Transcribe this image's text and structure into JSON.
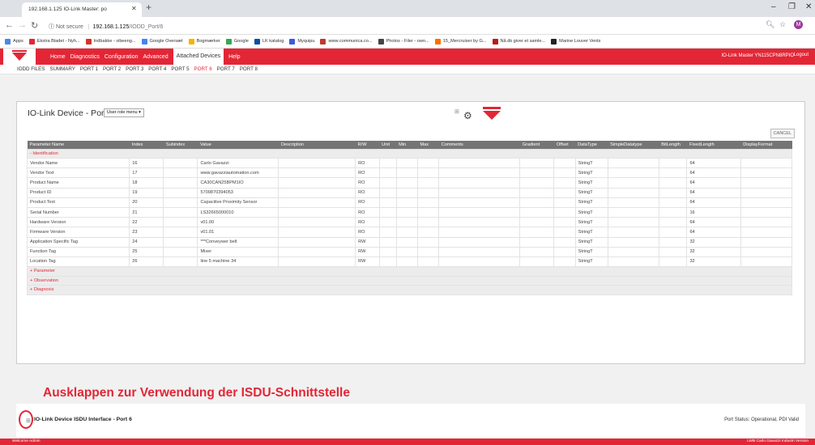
{
  "browser": {
    "tab_title": "192.168.1.125 IO-Link Master: po",
    "address_security": "Not secure",
    "address_host": "192.168.1.125",
    "address_path": "/IODD_Port/6",
    "avatar_letter": "M",
    "bookmarks": [
      {
        "label": "Apps",
        "color": "#4a87e6"
      },
      {
        "label": "Ekstra Bladet - Nyh...",
        "color": "#e32636"
      },
      {
        "label": "Indbakke - vibeeng...",
        "color": "#d93025"
      },
      {
        "label": "Google Oversæt",
        "color": "#4285f4"
      },
      {
        "label": "Bogmærker",
        "color": "#f4b400"
      },
      {
        "label": "Google",
        "color": "#34a853"
      },
      {
        "label": "LK katalog",
        "color": "#0b4ea2"
      },
      {
        "label": "Myquipu",
        "color": "#3b5bdb"
      },
      {
        "label": "www.communica.co...",
        "color": "#c0392b"
      },
      {
        "label": "Photos - Filer - own...",
        "color": "#444444"
      },
      {
        "label": "15_Mercruiser by G...",
        "color": "#ff6d00"
      },
      {
        "label": "Nå.dk giver et samle...",
        "color": "#b71c1c"
      },
      {
        "label": "Marine Louver Vents",
        "color": "#222222"
      }
    ]
  },
  "app": {
    "menu": [
      "Home",
      "Diagnostics",
      "Configuration",
      "Advanced",
      "Attached Devices",
      "Help"
    ],
    "menu_active": "Attached Devices",
    "master_label": "IO-Link Master YN115CPN8RPIO",
    "logout_label": "Logout",
    "subnav": [
      "IODD FILES",
      "SUMMARY",
      "PORT 1",
      "PORT 2",
      "PORT 3",
      "PORT 4",
      "PORT 5",
      "PORT 6",
      "PORT 7",
      "PORT 8"
    ],
    "subnav_active": "PORT 6"
  },
  "panel": {
    "title": "IO-Link Device - Port 6",
    "role_select": "User role menu ▾",
    "cancel_label": "CANCEL",
    "columns": [
      "Parameter Name",
      "Index",
      "Subindex",
      "Value",
      "Description",
      "R/W",
      "Unit",
      "Min",
      "Max",
      "Comments",
      "Gradient",
      "Offset",
      "DataType",
      "SimpleDatatype",
      "BitLength",
      "FixedLength",
      "DisplayFormat"
    ],
    "identification_label": "- Identification",
    "rows": [
      [
        "Vendor Name",
        "16",
        "",
        "Carlo Gavazzi",
        "",
        "RO",
        "",
        "",
        "",
        "",
        "",
        "",
        "StringT",
        "",
        "",
        "64",
        ""
      ],
      [
        "Vendor Text",
        "17",
        "",
        "www.gavazziautomation.com",
        "",
        "RO",
        "",
        "",
        "",
        "",
        "",
        "",
        "StringT",
        "",
        "",
        "64",
        ""
      ],
      [
        "Product Name",
        "18",
        "",
        "CA30CAN25BPM1IO",
        "",
        "RO",
        "",
        "",
        "",
        "",
        "",
        "",
        "StringT",
        "",
        "",
        "64",
        ""
      ],
      [
        "Product ID",
        "19",
        "",
        "5709870394053",
        "",
        "RO",
        "",
        "",
        "",
        "",
        "",
        "",
        "StringT",
        "",
        "",
        "64",
        ""
      ],
      [
        "Product Text",
        "20",
        "",
        "Capacitive Proximity Sensor",
        "",
        "RO",
        "",
        "",
        "",
        "",
        "",
        "",
        "StringT",
        "",
        "",
        "64",
        ""
      ],
      [
        "Serial Number",
        "21",
        "",
        "LS32665000010",
        "",
        "RO",
        "",
        "",
        "",
        "",
        "",
        "",
        "StringT",
        "",
        "",
        "16",
        ""
      ],
      [
        "Hardware Version",
        "22",
        "",
        "v01.00",
        "",
        "RO",
        "",
        "",
        "",
        "",
        "",
        "",
        "StringT",
        "",
        "",
        "64",
        ""
      ],
      [
        "Firmware Version",
        "23",
        "",
        "v01.01",
        "",
        "RO",
        "",
        "",
        "",
        "",
        "",
        "",
        "StringT",
        "",
        "",
        "64",
        ""
      ],
      [
        "Application Specific Tag",
        "24",
        "",
        "***Conveywer belt",
        "",
        "RW",
        "",
        "",
        "",
        "",
        "",
        "",
        "StringT",
        "",
        "",
        "32",
        ""
      ],
      [
        "Function Tag",
        "25",
        "",
        "Mixer",
        "",
        "RW",
        "",
        "",
        "",
        "",
        "",
        "",
        "StringT",
        "",
        "",
        "32",
        ""
      ],
      [
        "Location Tag",
        "26",
        "",
        "line 5 machine 34",
        "",
        "RW",
        "",
        "",
        "",
        "",
        "",
        "",
        "StringT",
        "",
        "",
        "32",
        ""
      ]
    ],
    "groups": [
      "+ Parameter",
      "+ Observation",
      "+ Diagnosis"
    ]
  },
  "annotation": "Ausklappen zur Verwendung der ISDU-Schnittstelle",
  "isdu": {
    "title": "IO-Link Device ISDU Interface - Port 6",
    "port_status": "Port Status: Operational, PDI Valid"
  },
  "footer": {
    "left": "Welcome Admin",
    "right": "LWB Carlo Gavazzi Industri Version"
  }
}
